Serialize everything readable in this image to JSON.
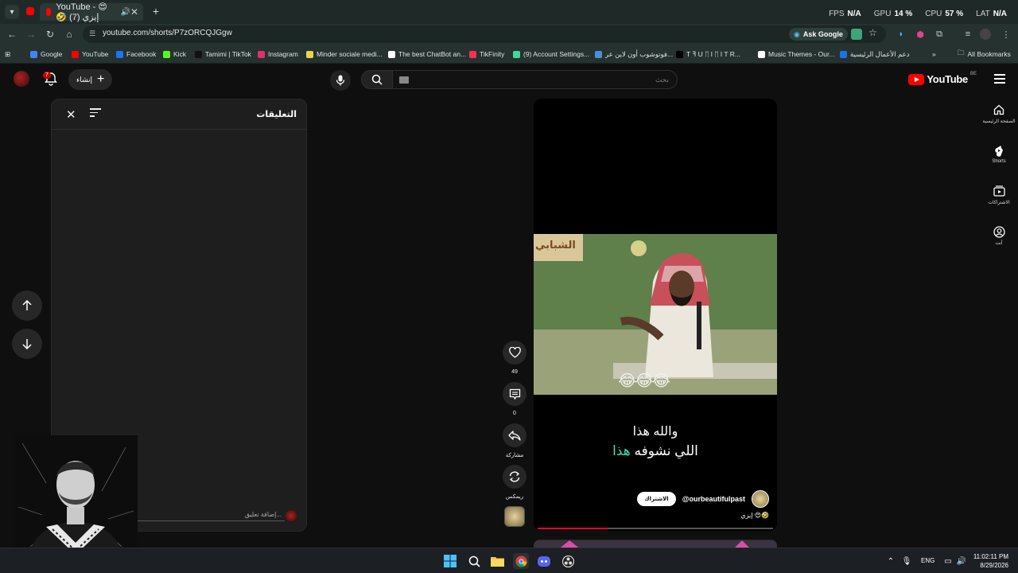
{
  "browser": {
    "tab_title": "YouTube - 😍🤣 (7) إيزي",
    "stats": [
      {
        "label": "FPS",
        "value": "N/A"
      },
      {
        "label": "GPU",
        "value": "14 %"
      },
      {
        "label": "CPU",
        "value": "57 %"
      },
      {
        "label": "LAT",
        "value": "N/A"
      }
    ],
    "url": "youtube.com/shorts/P7zORCQJGgw",
    "ask_google": "Ask Google",
    "bookmarks": [
      {
        "label": "Google",
        "color": "#4285f4"
      },
      {
        "label": "YouTube",
        "color": "#ff0000"
      },
      {
        "label": "Facebook",
        "color": "#1877f2"
      },
      {
        "label": "Kick",
        "color": "#53fc18"
      },
      {
        "label": "Tamimi | TikTok",
        "color": "#111111"
      },
      {
        "label": "Instagram",
        "color": "#e1306c"
      },
      {
        "label": "Minder sociale medi...",
        "color": "#e8d44d"
      },
      {
        "label": "The best ChatBot an...",
        "color": "#ffffff"
      },
      {
        "label": "TikFinity",
        "color": "#ff2d55"
      },
      {
        "label": "(9) Account Settings...",
        "color": "#3dd9a0"
      },
      {
        "label": "فوتوشوب أون لاين عر...",
        "color": "#4a90d9"
      },
      {
        "label": "T ꟻ U ᛖ I ᛖ I T R...",
        "color": "#000000"
      },
      {
        "label": "Music Themes - Our...",
        "color": "#ffffff"
      },
      {
        "label": "دعم الأعمال الرئيسية",
        "color": "#1a73e8"
      }
    ],
    "all_bookmarks": "All Bookmarks"
  },
  "yt": {
    "logo_text": "YouTube",
    "country": "BE",
    "search_placeholder": "بحث",
    "create_label": "إنشاء",
    "notif_count": "7",
    "guide": [
      {
        "label": "الصفحة الرئيسية",
        "icon": "home-icon"
      },
      {
        "label": "Shorts",
        "icon": "shorts-icon"
      },
      {
        "label": "الاشتراكات",
        "icon": "subscriptions-icon"
      },
      {
        "label": "أنت",
        "icon": "you-icon"
      }
    ]
  },
  "comments": {
    "title": "التعليقات",
    "input_placeholder": "إضافة تعليق..."
  },
  "short": {
    "caption_line1": "والله هذا",
    "caption_line2_a": "اللي نشوفه",
    "caption_line2_b": "هذا",
    "channel": "@ourbeautifulpast",
    "subscribe": "الاشتراك",
    "title": "إيزي 😍🤣",
    "progress": 0.3,
    "sign_text": "الشبابي",
    "emojis": "😂😂😂"
  },
  "actions": {
    "likes": "49",
    "comments": "0",
    "share": "مشاركة",
    "remix": "ريمكس"
  },
  "taskbar": {
    "lang": "ENG",
    "time": "11:02:11 PM",
    "date": "8/29/2026"
  }
}
